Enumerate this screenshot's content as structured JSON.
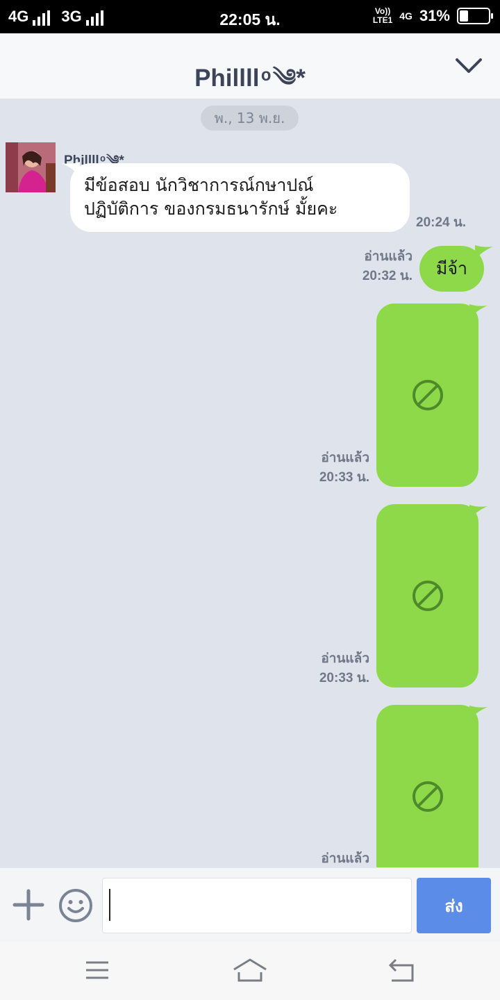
{
  "status_bar": {
    "network_1": "4G",
    "network_2": "3G",
    "time": "22:05 น.",
    "volte_line1": "Vo))",
    "volte_line2": "LTE1",
    "data_type": "4G",
    "battery_percent": "31%",
    "battery_level": 0.31
  },
  "header": {
    "title": "Phillll ͦ ༄*",
    "collapse_icon": "chevron-down-icon"
  },
  "chat": {
    "date_separator": "พ., 13 พ.ย.",
    "incoming": {
      "sender": "Phillll ͦ ༄*",
      "text_line1": "มีข้อสอบ นักวิชาการณ์กษาปณ์",
      "text_line2": "ปฏิบัติการ ของกรมธนารักษ์ มั้ยคะ",
      "time": "20:24 น."
    },
    "outgoing_text": {
      "text": "มีจ้า",
      "read_label": "อ่านแล้ว",
      "time": "20:32 น."
    },
    "media_messages": [
      {
        "read_label": "อ่านแล้ว",
        "time": "20:33 น.",
        "icon": "blocked-icon"
      },
      {
        "read_label": "อ่านแล้ว",
        "time": "20:33 น.",
        "icon": "blocked-icon"
      },
      {
        "read_label": "อ่านแล้ว",
        "icon": "blocked-icon"
      }
    ]
  },
  "composer": {
    "placeholder": "",
    "send_label": "ส่ง",
    "colors": {
      "send": "#5b8de8",
      "bubble_out": "#8ed94a"
    }
  },
  "navigation": {
    "icons": [
      "menu-icon",
      "home-icon",
      "back-icon"
    ]
  }
}
